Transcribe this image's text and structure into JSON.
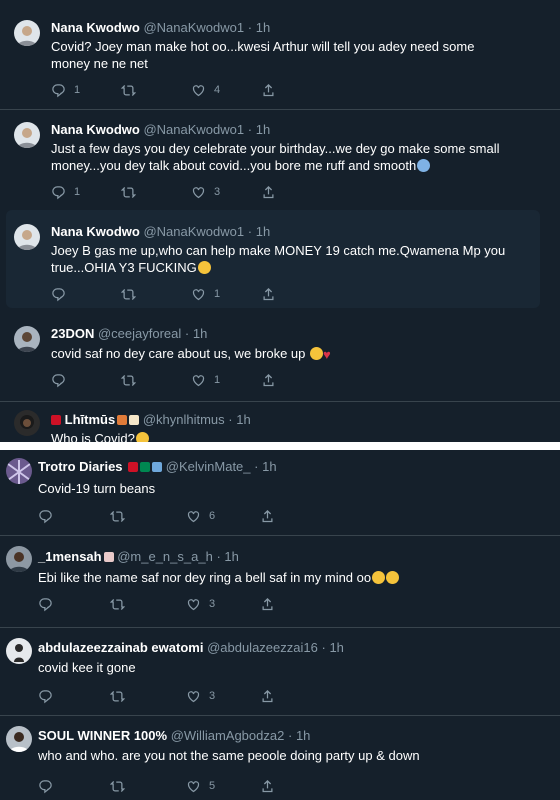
{
  "tweets_top": [
    {
      "name": "Nana Kwodwo",
      "handle": "@NanaKwodwo1",
      "sep": "·",
      "time": "1h",
      "text": "Covid? Joey man make hot oo...kwesi Arthur  will tell you adey need some money ne ne net",
      "replies": "1",
      "retweets": "",
      "likes": "4"
    },
    {
      "name": "Nana Kwodwo",
      "handle": "@NanaKwodwo1",
      "sep": "·",
      "time": "1h",
      "text": "Just a few days you dey celebrate your birthday...we dey go make some small money...you dey talk about covid...you bore me ruff and smooth",
      "replies": "1",
      "retweets": "",
      "likes": "3"
    },
    {
      "name": "Nana Kwodwo",
      "handle": "@NanaKwodwo1",
      "sep": "·",
      "time": "1h",
      "text": "Joey B gas me up,who can help make MONEY 19 catch me.Qwamena Mp you true...OHIA Y3 FUCKING",
      "replies": "",
      "retweets": "",
      "likes": "1"
    },
    {
      "name": "23DON",
      "handle": "@ceejayforeal",
      "sep": "·",
      "time": "1h",
      "text": "covid saf no dey care about us, we broke up",
      "replies": "",
      "retweets": "",
      "likes": "1"
    },
    {
      "name": "Lhītmūs",
      "handle": "@khynlhitmus",
      "sep": "·",
      "time": "1h",
      "text": "Who is Covid?"
    }
  ],
  "tweets_bottom": [
    {
      "name": "Trotro Diaries",
      "handle": "@KelvinMate_",
      "sep": "·",
      "time": "1h",
      "text": "Covid-19 turn beans",
      "replies": "",
      "retweets": "",
      "likes": "6"
    },
    {
      "name": "_1mensah",
      "handle": "@m_e_n_s_a_h",
      "sep": "·",
      "time": "1h",
      "text": "Ebi like the name saf nor dey ring a bell saf in my mind oo",
      "replies": "",
      "retweets": "",
      "likes": "3"
    },
    {
      "name": "abdulazeezzainab ewatomi",
      "handle": "@abdulazeezzai16",
      "sep": "·",
      "time": "1h",
      "text": "covid kee  it gone",
      "replies": "",
      "retweets": "",
      "likes": "3"
    },
    {
      "name": "SOUL WINNER 100%",
      "handle": "@WilliamAgbodza2",
      "sep": "·",
      "time": "1h",
      "text": "who and who. are you not the same peoole doing party up & down",
      "replies": "",
      "retweets": "",
      "likes": "5"
    }
  ],
  "icons": {
    "reply": "reply-icon",
    "retweet": "retweet-icon",
    "like": "like-icon",
    "share": "share-icon"
  },
  "colors": {
    "background": "#15202b",
    "highlight": "#192734",
    "muted": "#8899a6",
    "divider": "#ffffff"
  }
}
